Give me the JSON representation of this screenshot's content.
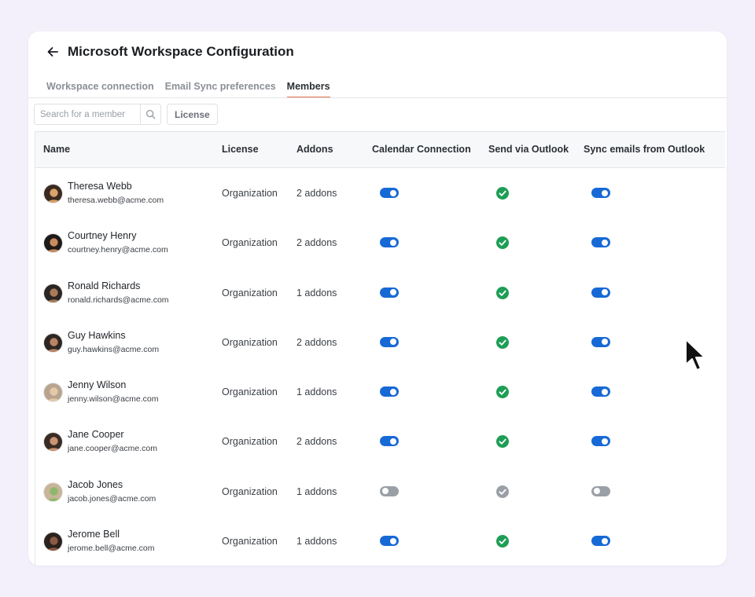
{
  "header": {
    "title": "Microsoft Workspace Configuration"
  },
  "tabs": [
    {
      "label": "Workspace connection"
    },
    {
      "label": "Email Sync preferences"
    },
    {
      "label": "Members"
    }
  ],
  "toolbar": {
    "search_placeholder": "Search for a member",
    "license_label": "License"
  },
  "table": {
    "columns": [
      "Name",
      "License",
      "Addons",
      "Calendar Connection",
      "Send via Outlook",
      "Sync emails from Outlook"
    ],
    "rows": [
      {
        "name": "Theresa Webb",
        "email": "theresa.webb@acme.com",
        "license": "Organization",
        "addons": "2 addons",
        "calendar": true,
        "send": true,
        "sync": true
      },
      {
        "name": "Courtney Henry",
        "email": "courtney.henry@acme.com",
        "license": "Organization",
        "addons": "2 addons",
        "calendar": true,
        "send": true,
        "sync": true
      },
      {
        "name": "Ronald Richards",
        "email": "ronald.richards@acme.com",
        "license": "Organization",
        "addons": "1 addons",
        "calendar": true,
        "send": true,
        "sync": true
      },
      {
        "name": "Guy Hawkins",
        "email": "guy.hawkins@acme.com",
        "license": "Organization",
        "addons": "2 addons",
        "calendar": true,
        "send": true,
        "sync": true
      },
      {
        "name": "Jenny Wilson",
        "email": "jenny.wilson@acme.com",
        "license": "Organization",
        "addons": "1 addons",
        "calendar": true,
        "send": true,
        "sync": true
      },
      {
        "name": "Jane Cooper",
        "email": "jane.cooper@acme.com",
        "license": "Organization",
        "addons": "2 addons",
        "calendar": true,
        "send": true,
        "sync": true
      },
      {
        "name": "Jacob Jones",
        "email": "jacob.jones@acme.com",
        "license": "Organization",
        "addons": "1 addons",
        "calendar": false,
        "send": false,
        "sync": false
      },
      {
        "name": "Jerome Bell",
        "email": "jerome.bell@acme.com",
        "license": "Organization",
        "addons": "1 addons",
        "calendar": true,
        "send": true,
        "sync": true
      }
    ]
  },
  "colors": {
    "accent_tab": "#e2714e",
    "toggle_on": "#1769d6",
    "toggle_off": "#9aa0a6",
    "check_on": "#1e9e55",
    "check_off": "#9aa0a6"
  }
}
